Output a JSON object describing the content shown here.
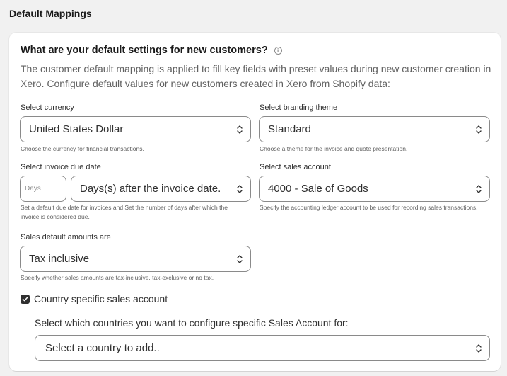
{
  "section": {
    "title": "Default Mappings"
  },
  "card": {
    "question": "What are your default settings for new customers?",
    "description": "The customer default mapping is applied to fill key fields with preset values during new customer creation in Xero. Configure default values for new customers created in Xero from Shopify data:"
  },
  "currency": {
    "label": "Select currency",
    "value": "United States Dollar",
    "help": "Choose the currency for financial transactions."
  },
  "branding": {
    "label": "Select branding theme",
    "value": "Standard",
    "help": "Choose a theme for the invoice and quote presentation."
  },
  "due_date": {
    "label": "Select invoice due date",
    "days_placeholder": "Days",
    "value": "Days(s) after the invoice date.",
    "help": "Set a default due date for invoices and Set the number of days after which the invoice is considered due."
  },
  "sales_account": {
    "label": "Select sales account",
    "value": "4000 - Sale of Goods",
    "help": "Specify the accounting ledger account to be used for recording sales transactions."
  },
  "amounts": {
    "label": "Sales default amounts are",
    "value": "Tax inclusive",
    "help": "Specify whether sales amounts are tax-inclusive, tax-exclusive or no tax."
  },
  "country_specific": {
    "checkbox_label": "Country specific sales account",
    "checked": true,
    "prompt": "Select which countries you want to configure specific Sales Account for:",
    "select_value": "Select a country to add.."
  },
  "icons": {
    "info": "info-icon",
    "chevron": "chevron-up-down-icon",
    "check": "checkmark-icon"
  }
}
